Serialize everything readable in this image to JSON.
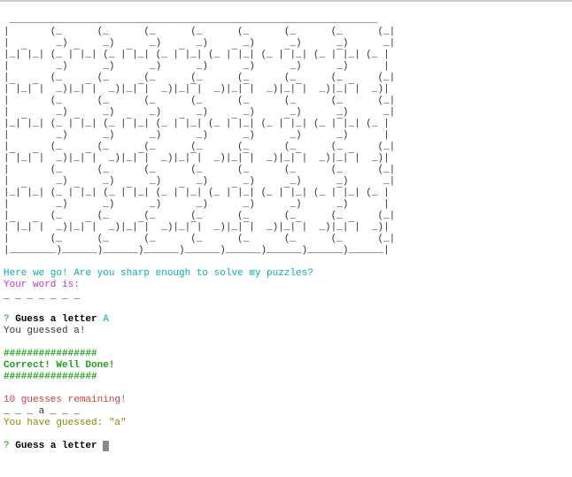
{
  "art": {
    "line01": " _______________________________________________________________",
    "line02": "|       (_      (_      (_      (_      (_      (_      (_      (_|",
    "line03": "|        _)      _)      _)      _)      _)      _)      _)      _|",
    "line04": "|_|¯|_| (_ |¯|_| (_ |¯|_| (_ |¯|_| (_ |¯|_| (_ |¯|_| (_ |¯|_| (_ |",
    "line05": "|        _)      _)      _)      _)      _)      _)      _)      |",
    "line06": "|       (_      (_      (_      (_      (_      (_      (_      (_|",
    "line07": "|¯|_|¯|  _)|_|¯|  _)|_|¯|  _)|_|¯|  _)|_|¯|  _)|_|¯|  _)|_|¯|  _)|",
    "line08": "|       (_      (_      (_      (_      (_      (_      (_      (_|",
    "line09": "|        _)      _)      _)      _)      _)      _)      _)      _|",
    "line10": "|_|¯|_| (_ |¯|_| (_ |¯|_| (_ |¯|_| (_ |¯|_| (_ |¯|_| (_ |¯|_| (_ |",
    "line11": "|        _)      _)      _)      _)      _)      _)      _)      |",
    "line12": "|       (_      (_      (_      (_      (_      (_      (_      (_|",
    "line13": "|¯|_|¯|  _)|_|¯|  _)|_|¯|  _)|_|¯|  _)|_|¯|  _)|_|¯|  _)|_|¯|  _)|",
    "line14": "|       (_      (_      (_      (_      (_      (_      (_      (_|",
    "line15": "|        _)      _)      _)      _)      _)      _)      _)      _|",
    "line16": "|_|¯|_| (_ |¯|_| (_ |¯|_| (_ |¯|_| (_ |¯|_| (_ |¯|_| (_ |¯|_| (_ |",
    "line17": "|        _)      _)      _)      _)      _)      _)      _)      |",
    "line18": "|       (_      (_      (_      (_      (_      (_      (_      (_|",
    "line19": "|¯|_|¯|  _)|_|¯|  _)|_|¯|  _)|_|¯|  _)|_|¯|  _)|_|¯|  _)|_|¯|  _)|",
    "line20": "|       (_      (_      (_      (_      (_      (_      (_      (_|",
    "line21": "|________)______)______)______)______)______)______)______)______|"
  },
  "intro": "Here we go! Are you sharp enough to solve my puzzles?",
  "word_is": "Your word is:",
  "blanks1": "_ _ _ _ _ _ _",
  "prompt_q": "?",
  "prompt_label": "Guess a letter",
  "prompt_space": " ",
  "guess1": "A",
  "you_guessed": "You guessed a!",
  "hash_line": "################",
  "correct": "Correct! Well Done!",
  "remaining": "10 guesses remaining!",
  "blanks2": "_ _ _ a _ _ _",
  "you_have_guessed": "You have guessed: \"a\""
}
